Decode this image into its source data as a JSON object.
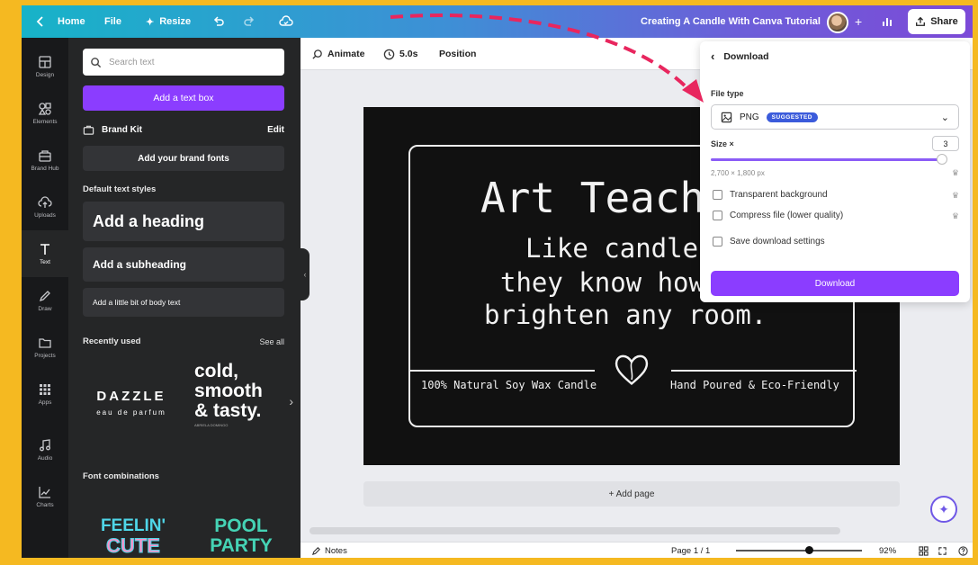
{
  "topbar": {
    "home": "Home",
    "file": "File",
    "resize": "Resize",
    "design_title": "Creating A Candle With Canva Tutorial",
    "share": "Share"
  },
  "rail": [
    {
      "label": "Design",
      "icon": "layout-icon"
    },
    {
      "label": "Elements",
      "icon": "shapes-icon"
    },
    {
      "label": "Brand Hub",
      "icon": "brand-icon"
    },
    {
      "label": "Uploads",
      "icon": "cloud-upload-icon"
    },
    {
      "label": "Text",
      "icon": "text-icon"
    },
    {
      "label": "Draw",
      "icon": "pen-icon"
    },
    {
      "label": "Projects",
      "icon": "folder-icon"
    },
    {
      "label": "Apps",
      "icon": "grid-icon"
    },
    {
      "label": "Audio",
      "icon": "music-icon"
    },
    {
      "label": "Charts",
      "icon": "chart-icon"
    }
  ],
  "panel": {
    "search_placeholder": "Search text",
    "add_text_box": "Add a text box",
    "brand_kit": "Brand Kit",
    "edit": "Edit",
    "add_brand_fonts": "Add your brand fonts",
    "default_styles": "Default text styles",
    "heading": "Add a heading",
    "subheading": "Add a subheading",
    "body": "Add a little bit of body text",
    "recently_used": "Recently used",
    "see_all": "See all",
    "dazzle": "DAZZLE",
    "dazzle_sub": "eau de parfum",
    "cold": "cold,",
    "smooth": "smooth",
    "tasty": "& tasty.",
    "cold_sub": "ABRIELA DOMINGO",
    "font_combinations": "Font combinations",
    "feelin": "FEELIN'",
    "cute": "CUTE",
    "pool": "POOL",
    "party": "PARTY"
  },
  "toolbar": {
    "animate": "Animate",
    "duration": "5.0s",
    "position": "Position"
  },
  "canvas": {
    "line1": "Art Teach",
    "line2": "Like candle",
    "line3": "they know how",
    "line4": "brighten any room.",
    "left_caption": "100% Natural Soy Wax Candle",
    "right_caption": "Hand Poured & Eco-Friendly",
    "add_page": "+ Add page"
  },
  "statusbar": {
    "notes": "Notes",
    "page": "Page 1 / 1",
    "zoom": "92%",
    "zoom_level": 0.55
  },
  "download": {
    "title": "Download",
    "file_type_label": "File type",
    "file_type": "PNG",
    "suggested": "SUGGESTED",
    "size_label": "Size ×",
    "size_value": "3",
    "size_fraction": 0.98,
    "dimensions": "2,700 × 1,800 px",
    "transparent": "Transparent background",
    "compress": "Compress file (lower quality)",
    "save_settings": "Save download settings",
    "button": "Download"
  },
  "colors": {
    "border": "#f5b921",
    "accent": "#8b3dff",
    "arrow": "#e8265e",
    "badge": "#3b5bdb"
  }
}
